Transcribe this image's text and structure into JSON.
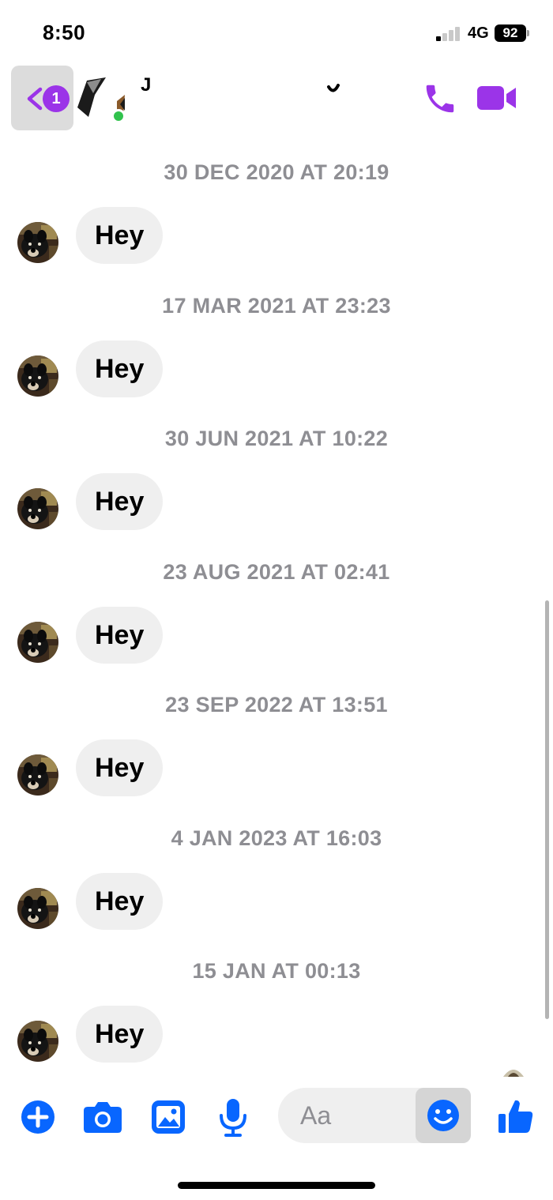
{
  "status_bar": {
    "time": "8:50",
    "network": "4G",
    "battery": "92"
  },
  "header": {
    "unread_count": "1",
    "contact_name": "J",
    "accent_color": "#9b34e8",
    "online_color": "#31c24d"
  },
  "messages": [
    {
      "timestamp": "30 DEC 2020 AT 20:19",
      "text": "Hey"
    },
    {
      "timestamp": "17 MAR 2021 AT 23:23",
      "text": "Hey"
    },
    {
      "timestamp": "30 JUN 2021 AT 10:22",
      "text": "Hey"
    },
    {
      "timestamp": "23 AUG 2021 AT 02:41",
      "text": "Hey"
    },
    {
      "timestamp": "23 SEP 2022 AT 13:51",
      "text": "Hey"
    },
    {
      "timestamp": "4 JAN 2023 AT 16:03",
      "text": "Hey"
    },
    {
      "timestamp": "15 JAN AT 00:13",
      "text": "Hey"
    }
  ],
  "composer": {
    "placeholder": "Aa",
    "tool_color": "#0866ff",
    "icons": [
      "plus-icon",
      "camera-icon",
      "gallery-icon",
      "microphone-icon",
      "emoji-icon",
      "thumbs-up-icon"
    ]
  }
}
